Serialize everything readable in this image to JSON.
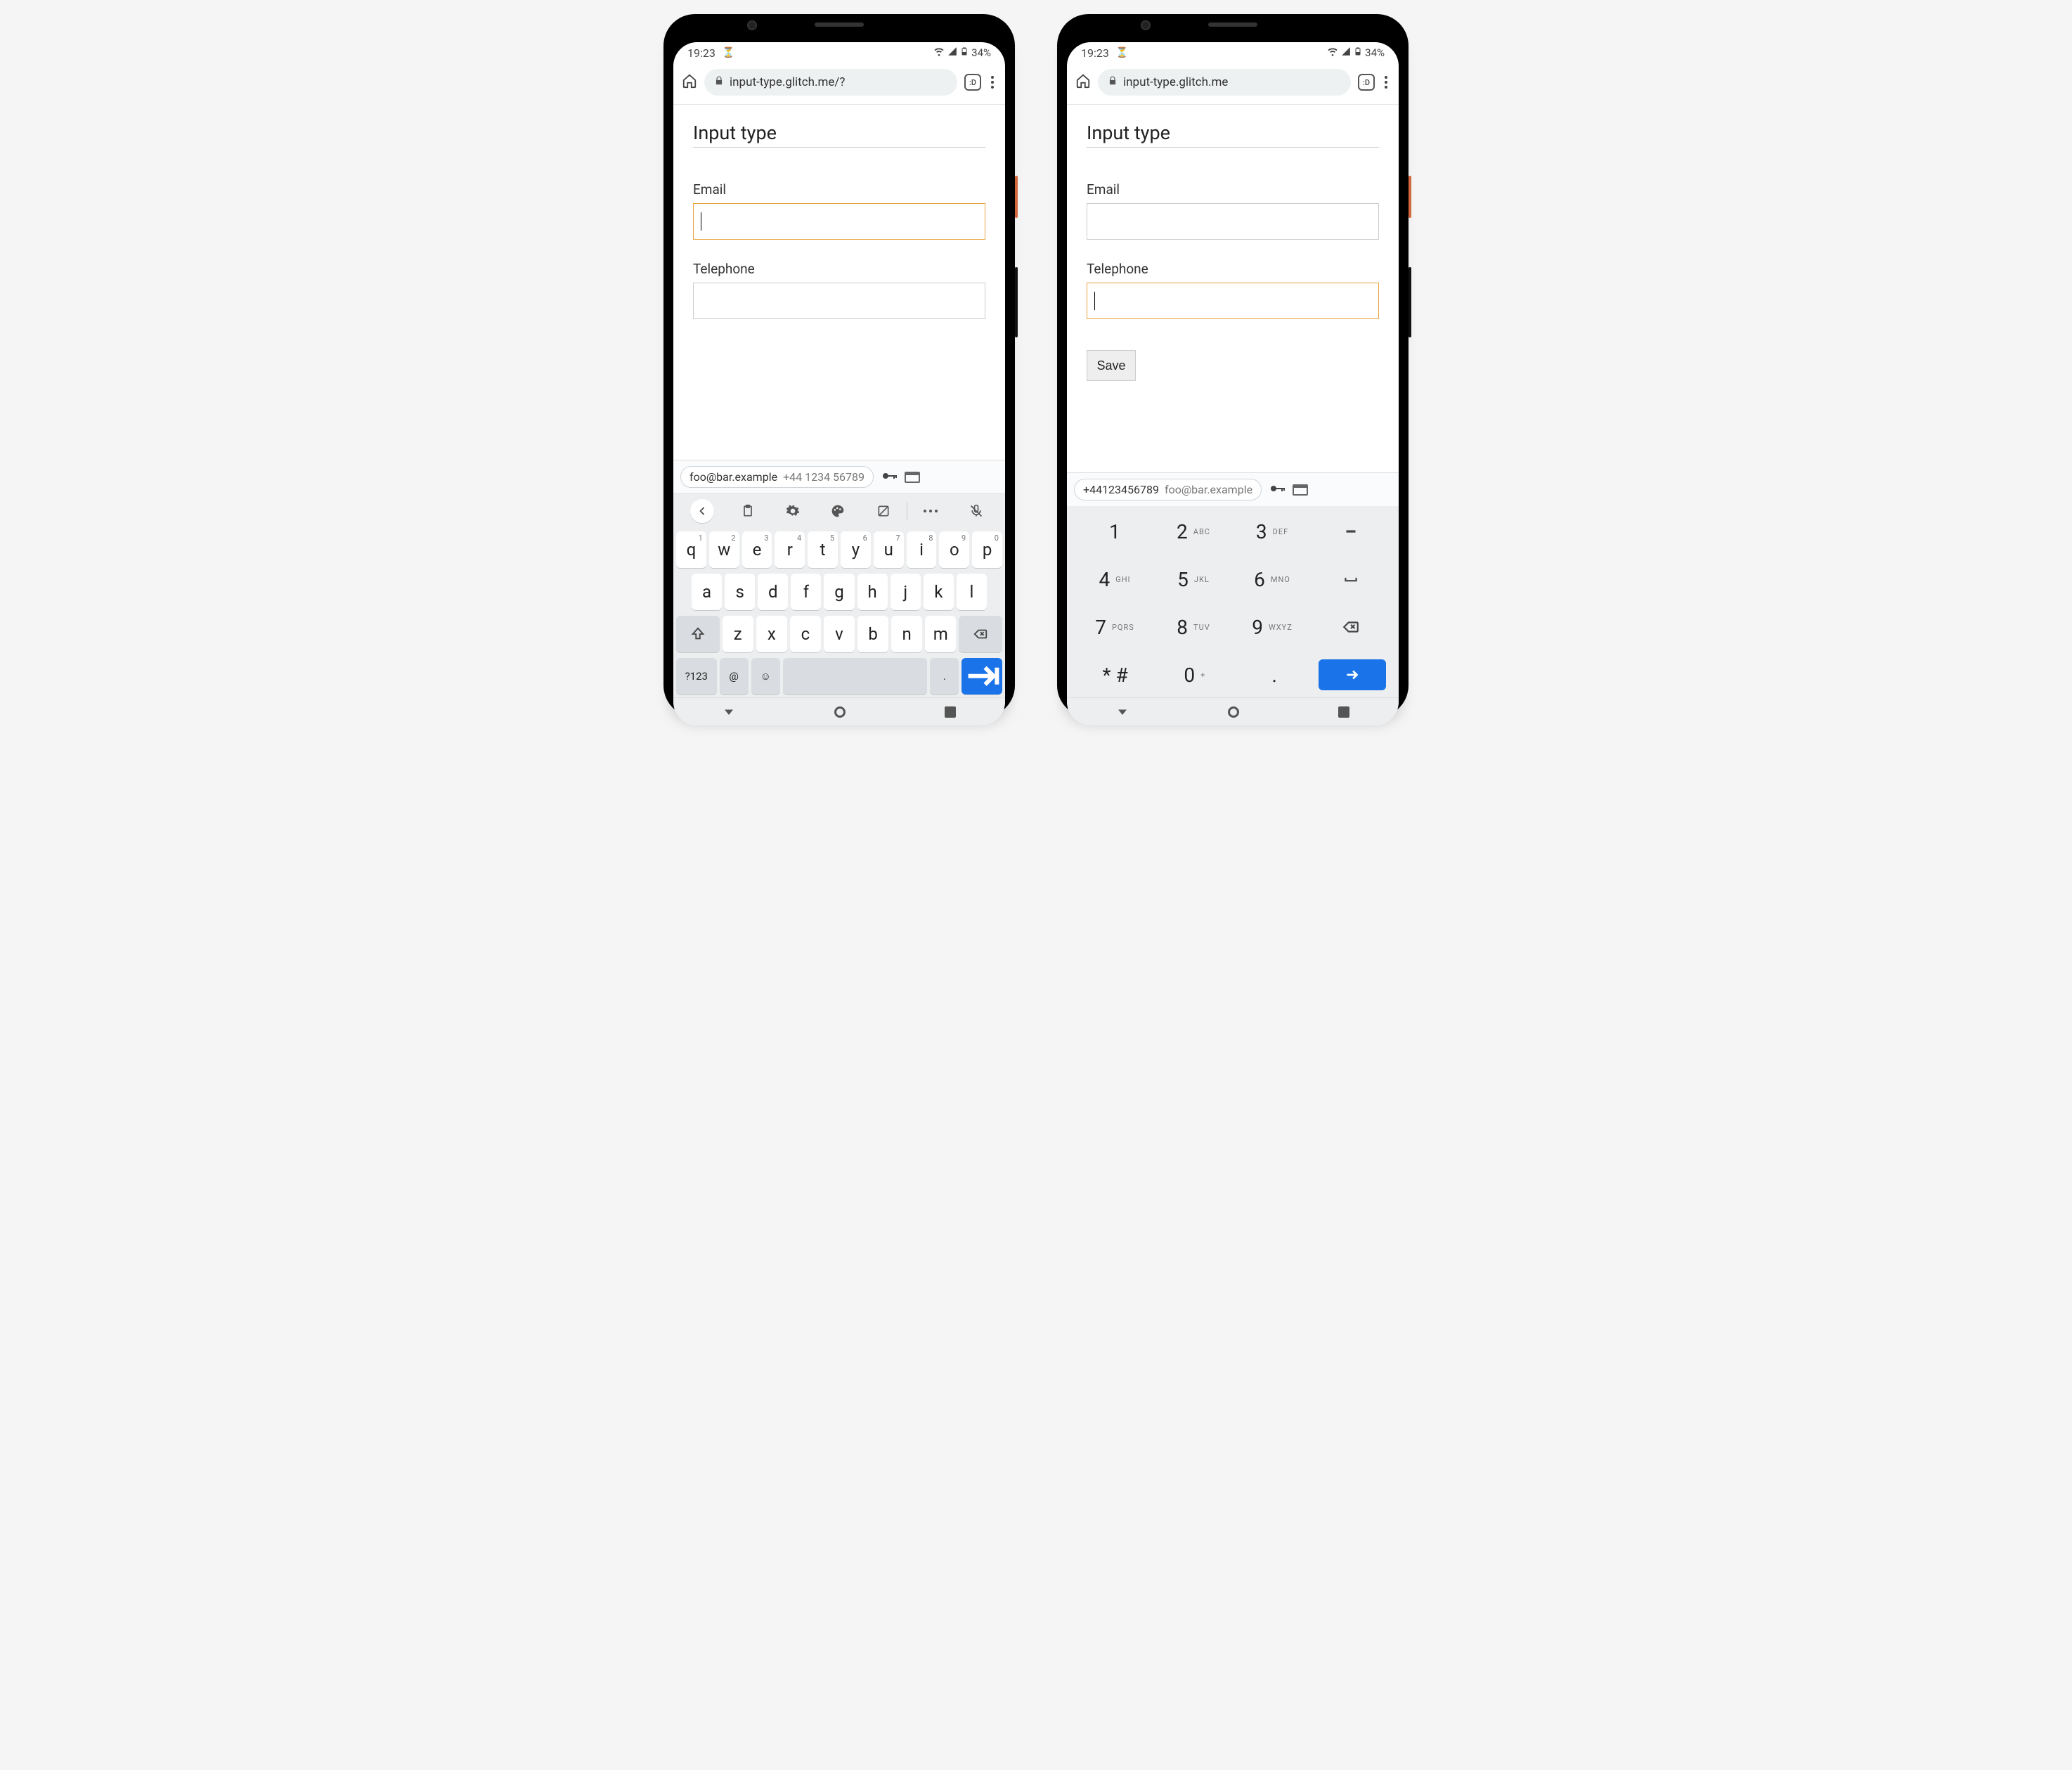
{
  "status": {
    "time": "19:23",
    "battery": "34%"
  },
  "browser": {
    "url_left": "input-type.glitch.me/?",
    "url_right": "input-type.glitch.me",
    "tab_label": ":D"
  },
  "page": {
    "title": "Input type",
    "email_label": "Email",
    "tel_label": "Telephone",
    "save_label": "Save"
  },
  "suggest": {
    "left_primary": "foo@bar.example",
    "left_secondary": "+44 1234 56789",
    "right_primary": "+44123456789",
    "right_secondary": "foo@bar.example"
  },
  "qwerty": {
    "row1": [
      {
        "k": "q",
        "n": "1"
      },
      {
        "k": "w",
        "n": "2"
      },
      {
        "k": "e",
        "n": "3"
      },
      {
        "k": "r",
        "n": "4"
      },
      {
        "k": "t",
        "n": "5"
      },
      {
        "k": "y",
        "n": "6"
      },
      {
        "k": "u",
        "n": "7"
      },
      {
        "k": "i",
        "n": "8"
      },
      {
        "k": "o",
        "n": "9"
      },
      {
        "k": "p",
        "n": "0"
      }
    ],
    "row2": [
      "a",
      "s",
      "d",
      "f",
      "g",
      "h",
      "j",
      "k",
      "l"
    ],
    "row3": [
      "z",
      "x",
      "c",
      "v",
      "b",
      "n",
      "m"
    ],
    "sym_label": "?123",
    "at_label": "@",
    "period": "."
  },
  "numpad": {
    "rows": [
      [
        {
          "d": "1",
          "s": ""
        },
        {
          "d": "2",
          "s": "ABC"
        },
        {
          "d": "3",
          "s": "DEF"
        },
        {
          "act": "dash"
        }
      ],
      [
        {
          "d": "4",
          "s": "GHI"
        },
        {
          "d": "5",
          "s": "JKL"
        },
        {
          "d": "6",
          "s": "MNO"
        },
        {
          "act": "space"
        }
      ],
      [
        {
          "d": "7",
          "s": "PQRS"
        },
        {
          "d": "8",
          "s": "TUV"
        },
        {
          "d": "9",
          "s": "WXYZ"
        },
        {
          "act": "back"
        }
      ],
      [
        {
          "d": "* #",
          "s": ""
        },
        {
          "d": "0",
          "s": "+"
        },
        {
          "d": ".",
          "s": ""
        },
        {
          "act": "enter"
        }
      ]
    ]
  }
}
